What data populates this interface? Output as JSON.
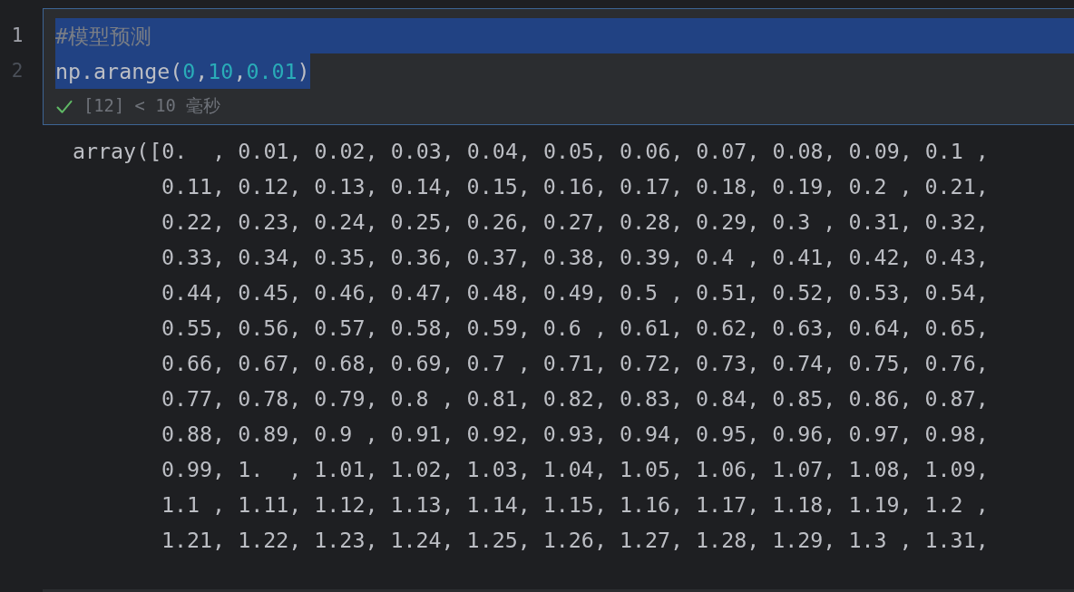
{
  "cell": {
    "selected": true,
    "lines": [
      {
        "number": "1",
        "current": true,
        "selected": true,
        "tokens": [
          {
            "kind": "comment",
            "text": "#模型预测"
          }
        ]
      },
      {
        "number": "2",
        "current": false,
        "selected": true,
        "tokens": [
          {
            "kind": "plain",
            "text": "np.arange("
          },
          {
            "kind": "number",
            "text": "0"
          },
          {
            "kind": "plain",
            "text": ","
          },
          {
            "kind": "number",
            "text": "10"
          },
          {
            "kind": "plain",
            "text": ","
          },
          {
            "kind": "number",
            "text": "0.01"
          },
          {
            "kind": "plain",
            "text": ")"
          }
        ]
      }
    ],
    "run_info": {
      "succeeded": true,
      "text": "[12] < 10 毫秒"
    }
  },
  "output": {
    "lines": [
      "array([0.  , 0.01, 0.02, 0.03, 0.04, 0.05, 0.06, 0.07, 0.08, 0.09, 0.1 ,",
      "0.11, 0.12, 0.13, 0.14, 0.15, 0.16, 0.17, 0.18, 0.19, 0.2 , 0.21,",
      "0.22, 0.23, 0.24, 0.25, 0.26, 0.27, 0.28, 0.29, 0.3 , 0.31, 0.32,",
      "0.33, 0.34, 0.35, 0.36, 0.37, 0.38, 0.39, 0.4 , 0.41, 0.42, 0.43,",
      "0.44, 0.45, 0.46, 0.47, 0.48, 0.49, 0.5 , 0.51, 0.52, 0.53, 0.54,",
      "0.55, 0.56, 0.57, 0.58, 0.59, 0.6 , 0.61, 0.62, 0.63, 0.64, 0.65,",
      "0.66, 0.67, 0.68, 0.69, 0.7 , 0.71, 0.72, 0.73, 0.74, 0.75, 0.76,",
      "0.77, 0.78, 0.79, 0.8 , 0.81, 0.82, 0.83, 0.84, 0.85, 0.86, 0.87,",
      "0.88, 0.89, 0.9 , 0.91, 0.92, 0.93, 0.94, 0.95, 0.96, 0.97, 0.98,",
      "0.99, 1.  , 1.01, 1.02, 1.03, 1.04, 1.05, 1.06, 1.07, 1.08, 1.09,",
      "1.1 , 1.11, 1.12, 1.13, 1.14, 1.15, 1.16, 1.17, 1.18, 1.19, 1.2 ,",
      "1.21, 1.22, 1.23, 1.24, 1.25, 1.26, 1.27, 1.28, 1.29, 1.3 , 1.31,"
    ]
  }
}
